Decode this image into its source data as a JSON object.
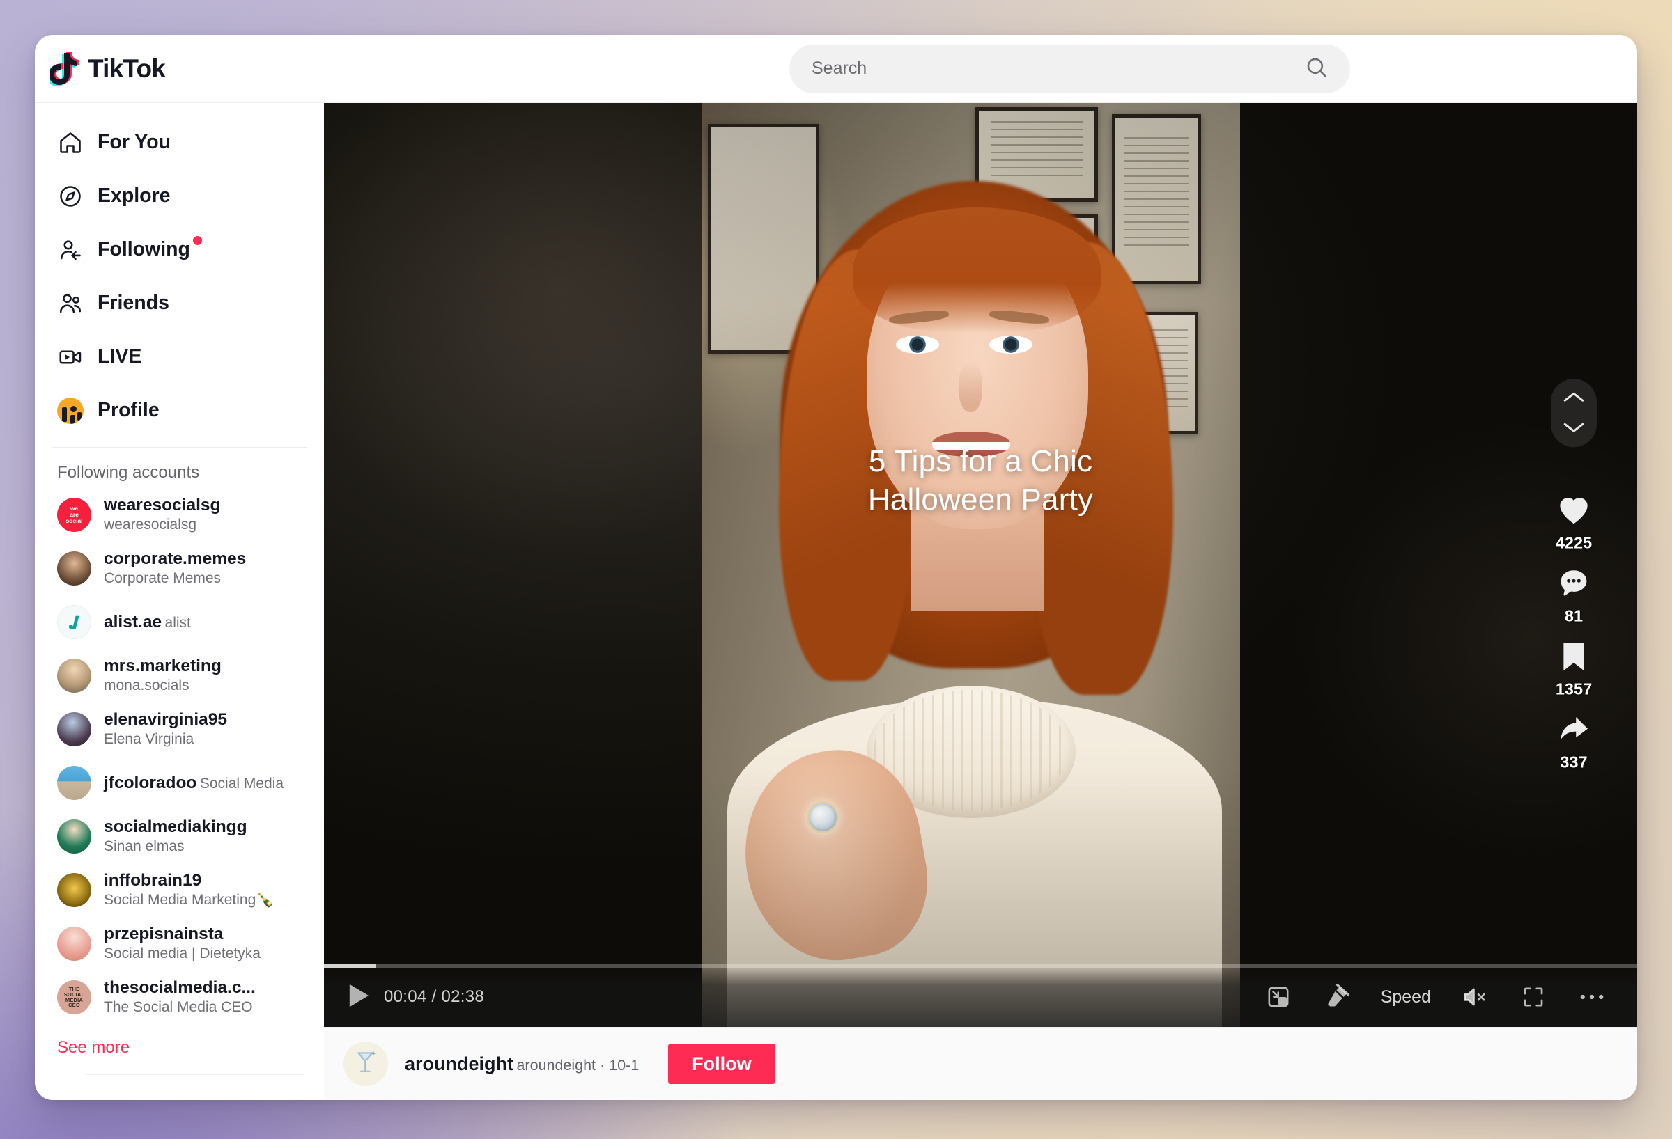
{
  "app": {
    "name": "TikTok",
    "logo_icon": "tiktok-note-icon"
  },
  "search": {
    "placeholder": "Search",
    "value": "",
    "icon": "search-icon"
  },
  "sidebar": {
    "nav": [
      {
        "label": "For You",
        "icon": "home-icon",
        "badge": false
      },
      {
        "label": "Explore",
        "icon": "compass-icon",
        "badge": false
      },
      {
        "label": "Following",
        "icon": "person-arrow-icon",
        "badge": true
      },
      {
        "label": "Friends",
        "icon": "people-icon",
        "badge": false
      },
      {
        "label": "LIVE",
        "icon": "live-video-icon",
        "badge": false
      },
      {
        "label": "Profile",
        "icon": "profile-avatar-icon",
        "badge": false
      }
    ],
    "following_heading": "Following accounts",
    "accounts": [
      {
        "name": "wearesocialsg",
        "sub": "wearesocialsg",
        "av_text": "we are social",
        "av_bg": "#f5203b",
        "av_fg": "#ffffff"
      },
      {
        "name": "corporate.memes",
        "sub": "Corporate Memes",
        "av_text": "",
        "av_bg": "#7b5a42",
        "av_fg": "#ffffff"
      },
      {
        "name": "alist.ae",
        "sub": "alist",
        "av_text": "",
        "av_bg": "#f4f7f7",
        "av_fg": "#0aa4a0"
      },
      {
        "name": "mrs.marketing",
        "sub": "mona.socials",
        "av_text": "",
        "av_bg": "#8d8d82",
        "av_fg": "#ffffff"
      },
      {
        "name": "elenavirginia95",
        "sub": "Elena Virginia",
        "av_text": "",
        "av_bg": "#7f97bb",
        "av_fg": "#ffffff"
      },
      {
        "name": "jfcoloradoo",
        "sub": "Social Media",
        "av_text": "",
        "av_bg": "#3f95c9",
        "av_fg": "#ffffff"
      },
      {
        "name": "socialmediakingg",
        "sub": "Sinan elmas",
        "av_text": "",
        "av_bg": "#1b7a55",
        "av_fg": "#ffffff"
      },
      {
        "name": "inffobrain19",
        "sub": "Social Media Marketing🍾",
        "av_text": "",
        "av_bg": "#c49a25",
        "av_fg": "#1b1b1b"
      },
      {
        "name": "przepisnainsta",
        "sub": "Social media | Dietetyka",
        "av_text": "",
        "av_bg": "#e99e93",
        "av_fg": "#ffffff"
      },
      {
        "name": "thesocialmedia.c...",
        "sub": "The Social Media CEO",
        "av_text": "THE SOCIAL MEDIA CEO",
        "av_bg": "#d8a493",
        "av_fg": "#3a2a24"
      }
    ],
    "see_more": "See more"
  },
  "video": {
    "caption_line1": "5 Tips for a Chic",
    "caption_line2": "Halloween Party",
    "progress_percent": 4,
    "controls": {
      "play_icon": "play-icon",
      "time": "00:04 / 02:38",
      "current_time": "00:04",
      "duration": "02:38",
      "pip_icon": "picture-in-picture-icon",
      "clear_mode_icon": "clear-mode-icon",
      "speed_label": "Speed",
      "volume_icon": "mute-icon",
      "fullscreen_icon": "fullscreen-icon",
      "more_icon": "more-options-icon"
    },
    "rail": {
      "prev_icon": "chevron-up-icon",
      "next_icon": "chevron-down-icon",
      "actions": [
        {
          "icon": "heart-icon",
          "count": "4225"
        },
        {
          "icon": "comment-icon",
          "count": "81"
        },
        {
          "icon": "bookmark-icon",
          "count": "1357"
        },
        {
          "icon": "share-icon",
          "count": "337"
        }
      ]
    }
  },
  "author": {
    "avatar_icon": "cocktail-glass-icon",
    "name": "aroundeight",
    "meta": "aroundeight · 10-1",
    "follow_label": "Follow"
  },
  "colors": {
    "brand_red": "#fe2c55",
    "brand_cyan": "#25f4ee",
    "text_primary": "#161823",
    "text_secondary": "#6f6f74"
  }
}
